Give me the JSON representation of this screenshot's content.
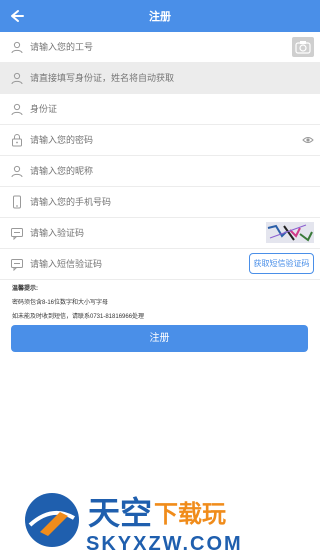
{
  "header": {
    "title": "注册",
    "back_icon": "arrow-left-icon"
  },
  "form": {
    "job_number_placeholder": "请输入您的工号",
    "name_placeholder": "请直接填写身份证，姓名将自动获取",
    "id_card_placeholder": "身份证",
    "password_placeholder": "请输入您的密码",
    "nickname_placeholder": "请输入您的昵称",
    "phone_placeholder": "请输入您的手机号码",
    "captcha_placeholder": "请输入验证码",
    "sms_placeholder": "请输入短信验证码",
    "sms_button": "获取短信验证码"
  },
  "tips": {
    "title": "温馨提示:",
    "line1": "密码须包含8-16位数字和大小写字母",
    "line2": "如未能及时收到短信，请联系0731-81816966处理"
  },
  "submit_label": "注册",
  "watermark": {
    "cn": "天空",
    "cn_accent": "下载玩",
    "url": "SKYXZW.COM"
  },
  "colors": {
    "accent": "#4a8fe8",
    "accent_orange": "#f08c1b"
  }
}
